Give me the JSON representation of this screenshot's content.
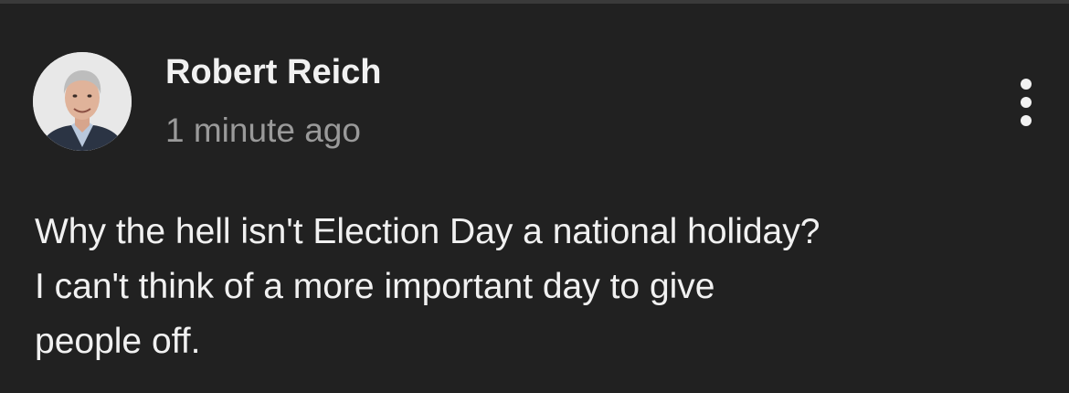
{
  "post": {
    "author": "Robert Reich",
    "timestamp": "1 minute ago",
    "body_lines": [
      "Why the hell isn't Election Day a national holiday?",
      "I can't think of a more important day to give",
      "people off."
    ],
    "more_icon": "more-vertical-icon"
  },
  "colors": {
    "background": "#212121",
    "text_primary": "#f1f1f1",
    "text_secondary": "#9a9a9a"
  }
}
